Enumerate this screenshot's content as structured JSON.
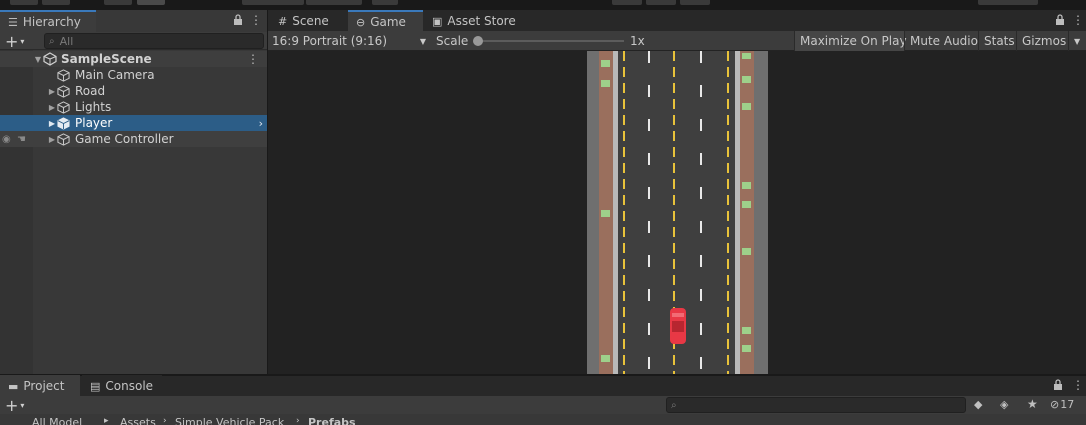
{
  "colors": {
    "selection": "#2c5d87",
    "active_tab_accent": "#3a79bb",
    "player_car": "#e83845",
    "road_line_yellow": "#e8c23a"
  },
  "hierarchy": {
    "tab_label": "Hierarchy",
    "search_placeholder": "All",
    "scene_name": "SampleScene",
    "items": [
      {
        "label": "Main Camera",
        "icon": "gameobject-cube-icon",
        "expandable": false
      },
      {
        "label": "Road",
        "icon": "gameobject-cube-icon",
        "expandable": true
      },
      {
        "label": "Lights",
        "icon": "gameobject-cube-icon",
        "expandable": true
      },
      {
        "label": "Player",
        "icon": "prefab-cube-icon",
        "expandable": true,
        "selected": true
      },
      {
        "label": "Game Controller",
        "icon": "gameobject-cube-icon",
        "expandable": true
      }
    ]
  },
  "view_tabs": [
    {
      "label": "Scene",
      "icon": "grid-icon"
    },
    {
      "label": "Game",
      "icon": "gamepad-icon",
      "active": true
    },
    {
      "label": "Asset Store",
      "icon": "shopping-bag-icon"
    }
  ],
  "game_toolbar": {
    "aspect": "16:9 Portrait (9:16)",
    "scale_label": "Scale",
    "scale_value": "1x",
    "scale_slider_level": 0,
    "maximize_on_play": "Maximize On Play",
    "mute_audio": "Mute Audio",
    "stats": "Stats",
    "gizmos": "Gizmos"
  },
  "bottom_tabs": [
    {
      "label": "Project",
      "icon": "folder-icon",
      "active": true
    },
    {
      "label": "Console",
      "icon": "console-icon"
    }
  ],
  "project": {
    "hidden_count": "17",
    "breadcrumbs": [
      "All Model",
      "Assets",
      "Simple Vehicle Pack",
      "Prefabs"
    ]
  }
}
